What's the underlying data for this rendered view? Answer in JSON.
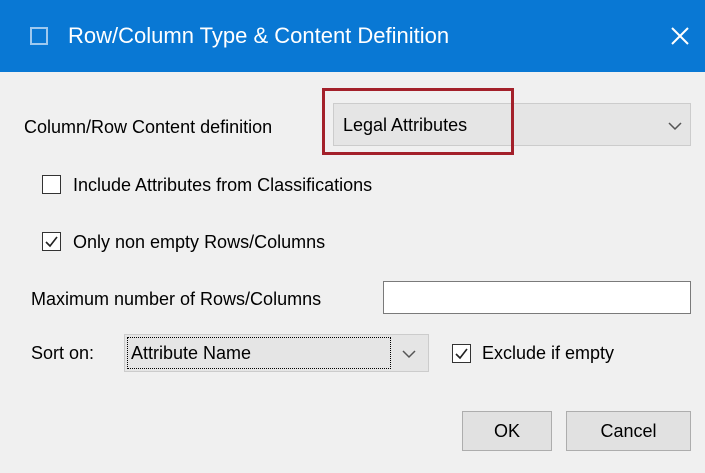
{
  "window": {
    "title": "Row/Column Type & Content Definition",
    "close_icon": "close-icon",
    "accent_color": "#0978d4"
  },
  "content_definition": {
    "label": "Column/Row Content definition",
    "selected": "Legal Attributes",
    "highlight_color": "#a3202a"
  },
  "include_classifications": {
    "label": "Include Attributes from Classifications",
    "checked": false
  },
  "only_non_empty": {
    "label": "Only non empty Rows/Columns",
    "checked": true
  },
  "max_rows": {
    "label": "Maximum number of Rows/Columns",
    "value": ""
  },
  "sort": {
    "label": "Sort on:",
    "selected": "Attribute Name"
  },
  "exclude_if_empty": {
    "label": "Exclude if empty",
    "checked": true
  },
  "buttons": {
    "ok": "OK",
    "cancel": "Cancel"
  }
}
